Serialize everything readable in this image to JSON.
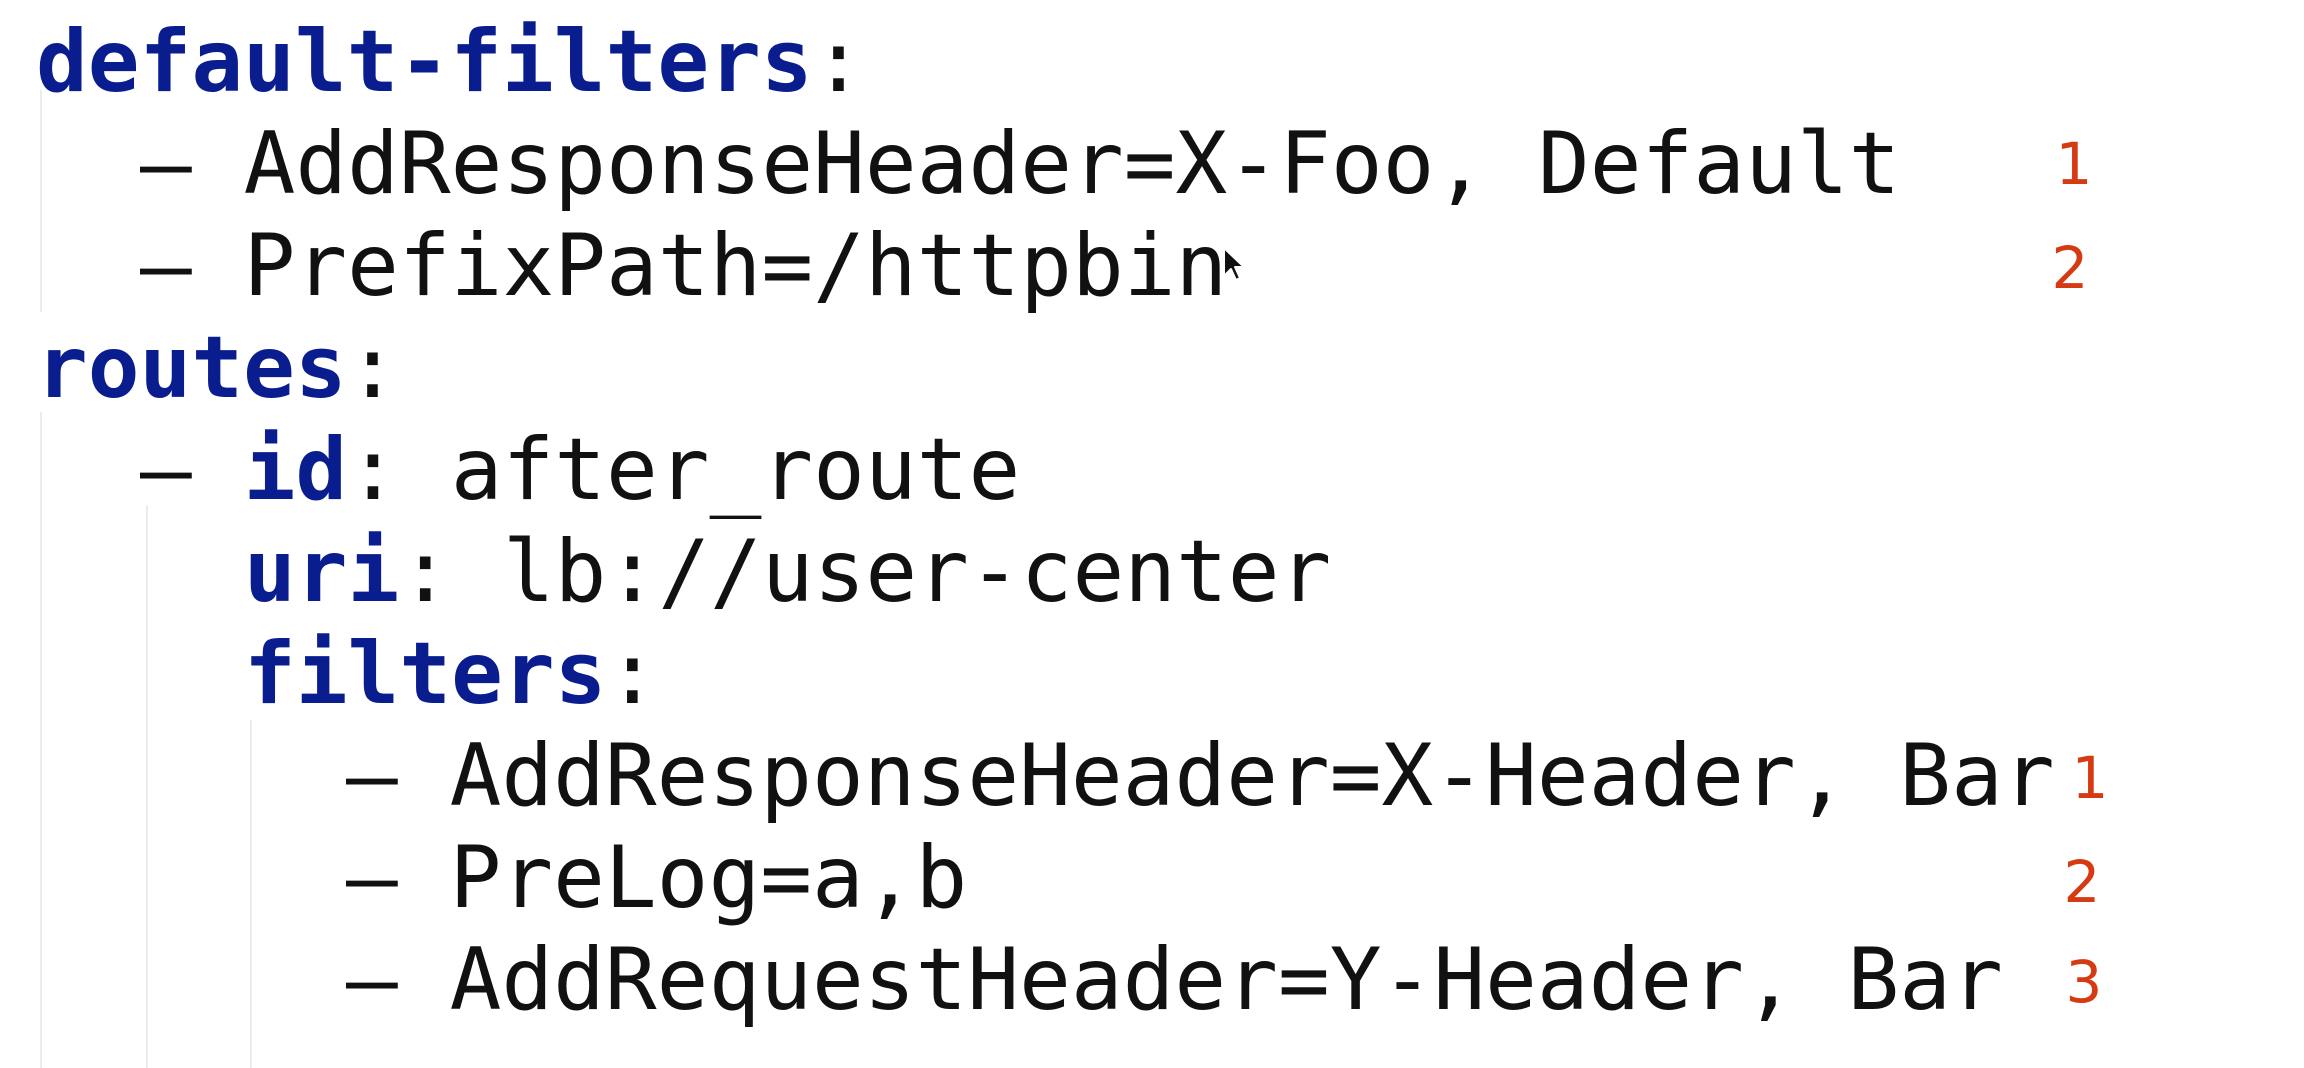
{
  "code": {
    "lines": [
      {
        "key": "default-filters",
        "sep": ":"
      },
      {
        "dash": "–",
        "value": "AddResponseHeader=X-Foo, Default"
      },
      {
        "dash": "–",
        "value": "PrefixPath=/httpbin"
      },
      {
        "key": "routes",
        "sep": ":"
      },
      {
        "dash": "–",
        "key": "id",
        "sep": ":",
        "value": "after_route"
      },
      {
        "key": "uri",
        "sep": ":",
        "value": "lb://user-center"
      },
      {
        "key": "filters",
        "sep": ":"
      },
      {
        "dash": "–",
        "value": "AddResponseHeader=X-Header, Bar"
      },
      {
        "dash": "–",
        "value": "PreLog=a,b"
      },
      {
        "dash": "–",
        "value": "AddRequestHeader=Y-Header, Bar"
      }
    ]
  },
  "annotations": {
    "default_filters": [
      "1",
      "2"
    ],
    "route_filters": [
      "1",
      "2",
      "3"
    ]
  },
  "colors": {
    "key": "#0a1d8f",
    "annotation": "#d63a12",
    "text": "#111111"
  },
  "icons": {
    "pointer": "mouse-pointer-icon"
  }
}
